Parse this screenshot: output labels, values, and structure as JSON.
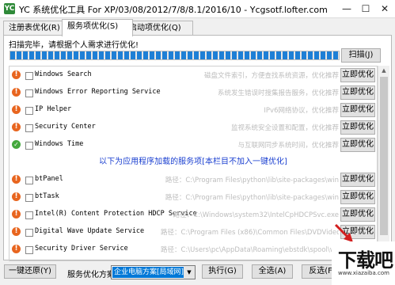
{
  "window": {
    "title": "YC 系统优化工具 For XP/03/08/2012/7/8/8.1/2016/10 - Ycgsotf.lofter.com",
    "icon": "app-icon",
    "controls": [
      "minimize-icon",
      "maximize-icon",
      "close-icon"
    ]
  },
  "tabs": [
    {
      "label": "注册表优化(R)",
      "active": false
    },
    {
      "label": "服务项优化(S)",
      "active": true
    },
    {
      "label": "启动项优化(Q)",
      "active": false
    }
  ],
  "scan": {
    "status_text": "扫描完毕，请根据个人需求进行优化!",
    "progress": 1.0,
    "scan_button": "扫描(J)"
  },
  "system_services": [
    {
      "name": "Windows Search",
      "desc": "磁盘文件索引，方便查找系统资源，优化推荐",
      "status": "warn",
      "button": "立即优化"
    },
    {
      "name": "Windows Error Reporting Service",
      "desc": "系统发生错误时搜集报告服务，优化推荐",
      "status": "warn",
      "button": "立即优化"
    },
    {
      "name": "IP Helper",
      "desc": "IPv6网络协议，优化推荐",
      "status": "warn",
      "button": "立即优化"
    },
    {
      "name": "Security Center",
      "desc": "监视系统安全设置和配置，优化推荐",
      "status": "warn",
      "button": "立即优化"
    },
    {
      "name": "Windows Time",
      "desc": "与互联网同步系统时间，优化推荐",
      "status": "ok",
      "button": "立即优化"
    }
  ],
  "divider_text": "以下为应用程序加载的服务项[本栏目不加入一键优化]",
  "app_services": [
    {
      "name": "btPanel",
      "desc": "路径：C:\\Program Files\\python\\lib\\site-packages\\win",
      "status": "warn",
      "button": "立即优化"
    },
    {
      "name": "btTask",
      "desc": "路径：C:\\Program Files\\python\\lib\\site-packages\\win",
      "status": "warn",
      "button": "立即优化"
    },
    {
      "name": "Intel(R) Content Protection HDCP Service",
      "desc": "路径：C:\\Windows\\system32\\IntelCpHDCPSvc.exe",
      "status": "warn",
      "button": "立即优化"
    },
    {
      "name": "Digital Wave Update Service",
      "desc": "路径：C:\\Program Files (x86)\\Common Files\\DVDVideoS",
      "status": "warn",
      "button": "立即优化"
    },
    {
      "name": "Security Driver Service",
      "desc": "路径：C:\\Users\\pc\\AppData\\Roaming\\ebstdk\\spool\\wsprin",
      "status": "warn",
      "button": "立即优化"
    }
  ],
  "bottom": {
    "restore_button": "一键还原(Y)",
    "plan_label": "服务优化方案：",
    "plan_value": "企业电脑方案[局域网]",
    "execute_button": "执行(G)",
    "select_all_button": "全选(A)",
    "invert_button": "反选(F)"
  },
  "watermark": {
    "main": "下载吧",
    "sub": "www.xiazaiba.com"
  },
  "colors": {
    "accent": "#0078d7",
    "warn": "#e8651f",
    "ok": "#45a83d",
    "link": "#1a3fd0"
  }
}
